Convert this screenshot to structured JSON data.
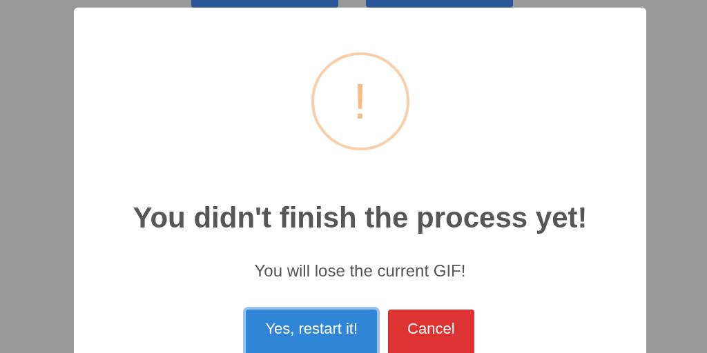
{
  "background": {
    "buttons": [
      {
        "kind": "button"
      },
      {
        "kind": "button"
      }
    ]
  },
  "dialog": {
    "icon": "!",
    "title": "You didn't finish the process yet!",
    "text": "You will lose the current GIF!",
    "buttons": [
      {
        "kind": "confirm",
        "label": "Yes, restart it!",
        "focused": true
      },
      {
        "kind": "cancel",
        "label": "Cancel",
        "focused": false
      }
    ]
  }
}
